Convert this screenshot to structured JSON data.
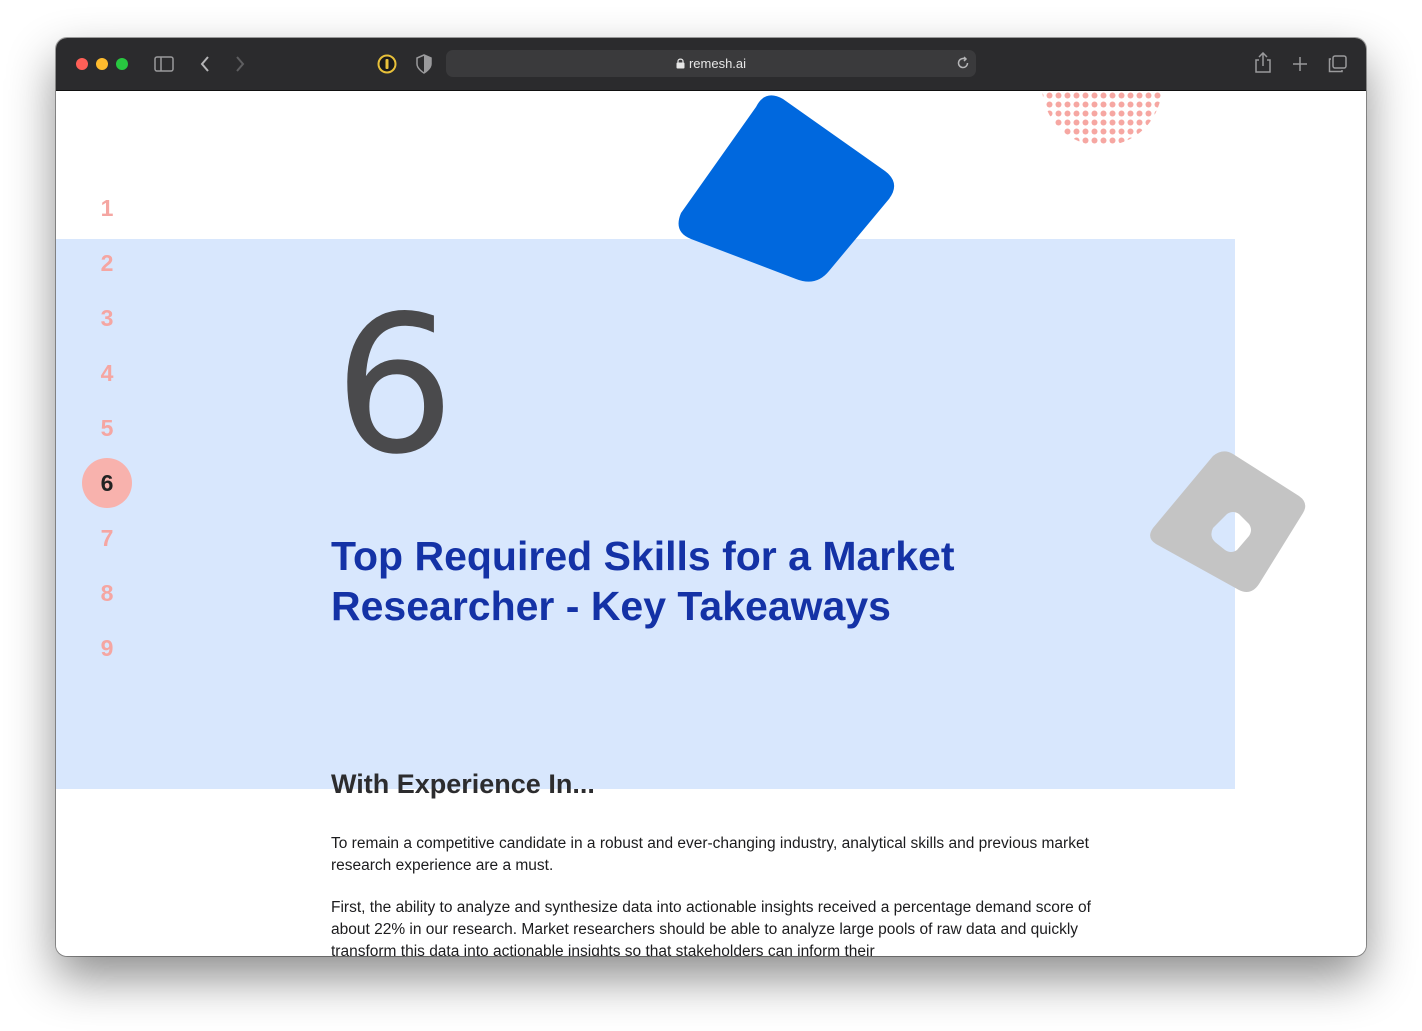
{
  "browser": {
    "url": "remesh.ai",
    "traffic_lights": [
      "#fe5f57",
      "#febc2e",
      "#28c840"
    ]
  },
  "steps": [
    {
      "label": "1",
      "active": false
    },
    {
      "label": "2",
      "active": false
    },
    {
      "label": "3",
      "active": false
    },
    {
      "label": "4",
      "active": false
    },
    {
      "label": "5",
      "active": false
    },
    {
      "label": "6",
      "active": true
    },
    {
      "label": "7",
      "active": false
    },
    {
      "label": "8",
      "active": false
    },
    {
      "label": "9",
      "active": false
    }
  ],
  "section": {
    "number": "6",
    "title": "Top Required Skills for a Market Researcher - Key Takeaways",
    "subheading": "With Experience In...",
    "paragraphs": [
      "To remain a competitive candidate in a robust and ever-changing industry, analytical skills and previous market research experience are a must.",
      "First, the ability to analyze and synthesize data into actionable insights received a percentage demand score of about 22% in our research. Market researchers should be able to analyze large pools of raw data and quickly transform this data into actionable insights so that stakeholders can inform their"
    ]
  },
  "colors": {
    "band": "#d8e7fd",
    "title": "#1432a6",
    "step_inactive": "#f5a6a2",
    "step_active_bg": "#f8b2ad",
    "blue_shape": "#0068de",
    "gray_shape": "#c4c4c4",
    "dots": "#f6a7a2"
  }
}
